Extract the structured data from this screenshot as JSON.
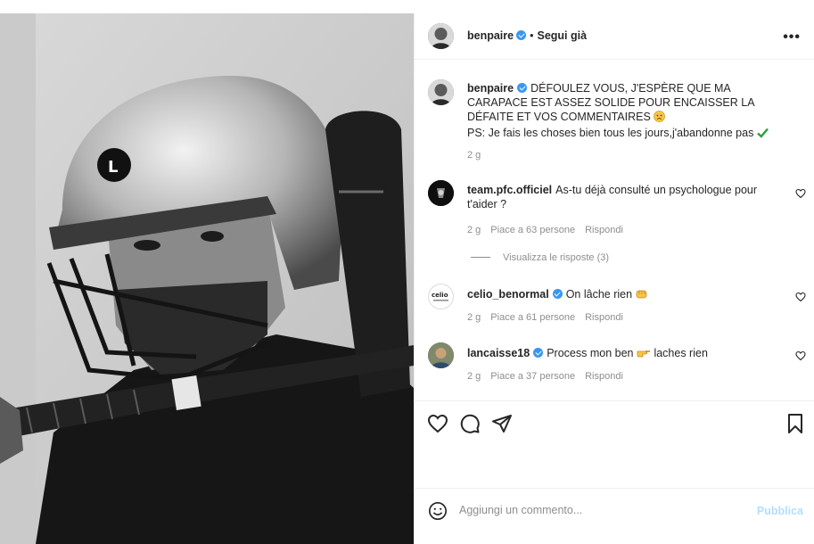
{
  "post": {
    "username": "benpaire",
    "follow_label": "Segui già",
    "more_label": "•••",
    "caption_username": "benpaire",
    "caption_line1": "DÉFOULEZ VOUS, J'ESPÈRE QUE MA CARAPACE EST ASSEZ SOLIDE POUR ENCAISSER LA DÉFAITE ET VOS COMMENTAIRES",
    "caption_line2": "PS: Je fais les choses bien tous les jours,j'abandonne pas",
    "caption_time": "2 g",
    "helmet_letter": "L"
  },
  "comments": [
    {
      "username": "team.pfc.officiel",
      "text": "As-tu déjà consulté un psychologue pour t'aider ?",
      "time": "2 g",
      "likes": "Piace a 63 persone",
      "reply": "Rispondi",
      "view_replies": "Visualizza le risposte (3)",
      "verified": false
    },
    {
      "username": "celio_benormal",
      "text": "On lâche rien",
      "time": "2 g",
      "likes": "Piace a 61 persone",
      "reply": "Rispondi",
      "avatar_text": "celio",
      "verified": true
    },
    {
      "username": "lancaisse18",
      "text_before": "Process mon ben",
      "text_after": "laches rien",
      "time": "2 g",
      "likes": "Piace a 37 persone",
      "reply": "Rispondi",
      "verified": true
    }
  ],
  "add_comment": {
    "placeholder": "Aggiungi un commento...",
    "publish_label": "Pubblica"
  },
  "colors": {
    "verified": "#3897f0",
    "secondary_text": "#8e8e8e",
    "publish_disabled": "#b2dffc",
    "check_green": "#2e9e3e"
  }
}
